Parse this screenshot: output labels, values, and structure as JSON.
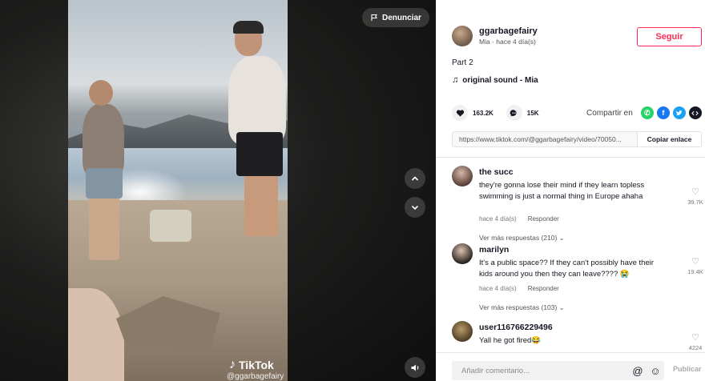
{
  "video": {
    "report_label": "Denunciar",
    "watermark_brand": "TikTok",
    "watermark_user": "@ggarbagefairy"
  },
  "author": {
    "username": "ggarbagefairy",
    "subtitle": "Mia · hace 4 día(s)",
    "follow_label": "Seguir"
  },
  "caption": "Part 2",
  "music": "original sound - Mia",
  "stats": {
    "likes": "163.2K",
    "comments": "15K"
  },
  "share": {
    "label": "Compartir en",
    "icons": [
      "whatsapp-icon",
      "facebook-icon",
      "twitter-icon",
      "embed-icon"
    ]
  },
  "link": {
    "url": "https://www.tiktok.com/@ggarbagefairy/video/70050...",
    "copy_label": "Copiar enlace"
  },
  "comments": [
    {
      "user": "the succ",
      "text": "they're gonna lose their mind if they learn topless swimming is just a normal thing in Europe ahaha",
      "time": "hace 4 día(s)",
      "reply": "Responder",
      "likes": "39.7K",
      "more": "Ver más respuestas (210)"
    },
    {
      "user": "marilyn",
      "text": "It's a public space?? If they can't possibly have their kids around you then they can leave???? 😭",
      "time": "hace 4 día(s)",
      "reply": "Responder",
      "likes": "19.4K",
      "more": "Ver más respuestas (103)"
    },
    {
      "user": "user116766229496",
      "text": "Yall he got fired😂",
      "likes": "4224"
    }
  ],
  "comment_bar": {
    "placeholder": "Añadir comentario...",
    "publish_label": "Publicar"
  },
  "colors": {
    "accent": "#fe2c55",
    "whatsapp": "#25d366",
    "facebook": "#1877f2",
    "twitter": "#1da1f2",
    "embed": "#161823"
  }
}
